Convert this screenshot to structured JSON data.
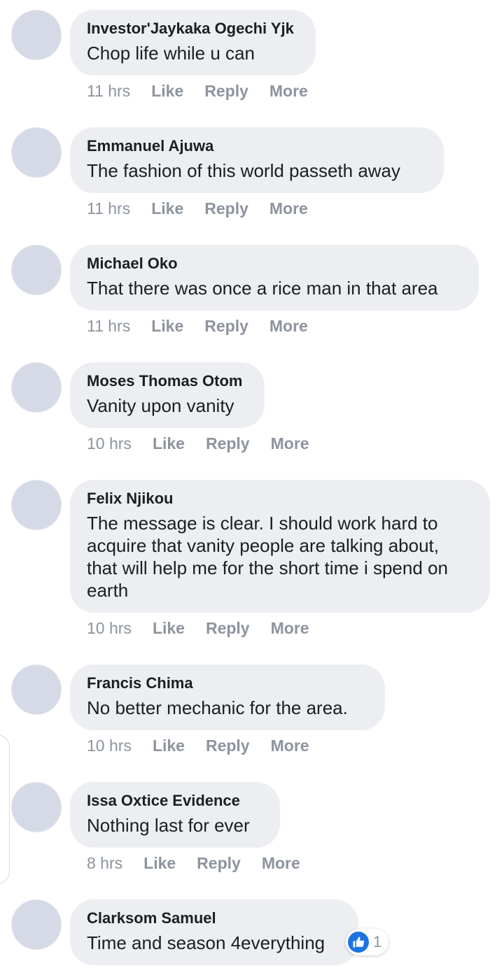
{
  "comments": [
    {
      "author": "Investor'Jaykaka Ogechi Yjk",
      "text": "Chop life while u can",
      "time": "11 hrs",
      "like": "Like",
      "reply": "Reply",
      "more": "More"
    },
    {
      "author": "Emmanuel Ajuwa",
      "text": "The fashion of this world passeth away",
      "time": "11 hrs",
      "like": "Like",
      "reply": "Reply",
      "more": "More"
    },
    {
      "author": "Michael Oko",
      "text": "That there was once a rice man in that area",
      "time": "11 hrs",
      "like": "Like",
      "reply": "Reply",
      "more": "More"
    },
    {
      "author": "Moses Thomas Otom",
      "text": "Vanity upon vanity",
      "time": "10 hrs",
      "like": "Like",
      "reply": "Reply",
      "more": "More"
    },
    {
      "author": "Felix Njikou",
      "text": "The message is clear. I should work hard to acquire that vanity people are talking about, that will help me for the short time i spend on earth",
      "time": "10 hrs",
      "like": "Like",
      "reply": "Reply",
      "more": "More"
    },
    {
      "author": "Francis Chima",
      "text": "No better mechanic for the area.",
      "time": "10 hrs",
      "like": "Like",
      "reply": "Reply",
      "more": "More"
    },
    {
      "author": "Issa Oxtice Evidence",
      "text": "Nothing last for ever",
      "time": "8 hrs",
      "like": "Like",
      "reply": "Reply",
      "more": "More"
    },
    {
      "author": "Clarksom Samuel",
      "text": "Time and season 4everything",
      "reaction": {
        "icon": "thumbs-up-icon",
        "count": "1",
        "color": "#1b74e4"
      }
    }
  ]
}
